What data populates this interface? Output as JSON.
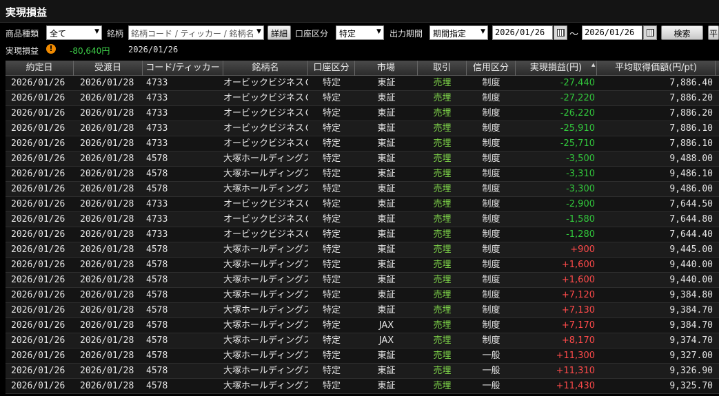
{
  "title": "実現損益",
  "filters": {
    "product_label": "商品種類",
    "product_value": "全て",
    "brand_label": "銘柄",
    "brand_placeholder": "銘柄コード / ティッカー / 銘柄名",
    "detail_button": "詳細",
    "account_label": "口座区分",
    "account_value": "特定",
    "period_label": "出力期間",
    "period_value": "期間指定",
    "date_from": "2026/01/26",
    "tilde": "～",
    "date_to": "2026/01/26",
    "search_button": "検索",
    "cut_button": "平"
  },
  "summary": {
    "label": "実現損益",
    "warning_glyph": "!",
    "value": "-80,640円",
    "date": "2026/01/26"
  },
  "table": {
    "headers": [
      "約定日",
      "受渡日",
      "コード/ティッカー",
      "銘柄名",
      "口座区分",
      "市場",
      "取引",
      "信用区分",
      "実現損益(円)",
      "平均取得価額(円/pt)"
    ],
    "rows": [
      [
        "2026/01/26",
        "2026/01/28",
        "4733",
        "オービックビジネスＣ",
        "特定",
        "東証",
        "売埋",
        "制度",
        "-27,440",
        "7,886.40"
      ],
      [
        "2026/01/26",
        "2026/01/28",
        "4733",
        "オービックビジネスＣ",
        "特定",
        "東証",
        "売埋",
        "制度",
        "-27,220",
        "7,886.20"
      ],
      [
        "2026/01/26",
        "2026/01/28",
        "4733",
        "オービックビジネスＣ",
        "特定",
        "東証",
        "売埋",
        "制度",
        "-26,220",
        "7,886.20"
      ],
      [
        "2026/01/26",
        "2026/01/28",
        "4733",
        "オービックビジネスＣ",
        "特定",
        "東証",
        "売埋",
        "制度",
        "-25,910",
        "7,886.10"
      ],
      [
        "2026/01/26",
        "2026/01/28",
        "4733",
        "オービックビジネスＣ",
        "特定",
        "東証",
        "売埋",
        "制度",
        "-25,710",
        "7,886.10"
      ],
      [
        "2026/01/26",
        "2026/01/28",
        "4578",
        "大塚ホールディングス",
        "特定",
        "東証",
        "売埋",
        "制度",
        "-3,500",
        "9,488.00"
      ],
      [
        "2026/01/26",
        "2026/01/28",
        "4578",
        "大塚ホールディングス",
        "特定",
        "東証",
        "売埋",
        "制度",
        "-3,310",
        "9,486.10"
      ],
      [
        "2026/01/26",
        "2026/01/28",
        "4578",
        "大塚ホールディングス",
        "特定",
        "東証",
        "売埋",
        "制度",
        "-3,300",
        "9,486.00"
      ],
      [
        "2026/01/26",
        "2026/01/28",
        "4733",
        "オービックビジネスＣ",
        "特定",
        "東証",
        "売埋",
        "制度",
        "-2,900",
        "7,644.50"
      ],
      [
        "2026/01/26",
        "2026/01/28",
        "4733",
        "オービックビジネスＣ",
        "特定",
        "東証",
        "売埋",
        "制度",
        "-1,580",
        "7,644.80"
      ],
      [
        "2026/01/26",
        "2026/01/28",
        "4733",
        "オービックビジネスＣ",
        "特定",
        "東証",
        "売埋",
        "制度",
        "-1,280",
        "7,644.40"
      ],
      [
        "2026/01/26",
        "2026/01/28",
        "4578",
        "大塚ホールディングス",
        "特定",
        "東証",
        "売埋",
        "制度",
        "+900",
        "9,445.00"
      ],
      [
        "2026/01/26",
        "2026/01/28",
        "4578",
        "大塚ホールディングス",
        "特定",
        "東証",
        "売埋",
        "制度",
        "+1,600",
        "9,440.00"
      ],
      [
        "2026/01/26",
        "2026/01/28",
        "4578",
        "大塚ホールディングス",
        "特定",
        "東証",
        "売埋",
        "制度",
        "+1,600",
        "9,440.00"
      ],
      [
        "2026/01/26",
        "2026/01/28",
        "4578",
        "大塚ホールディングス",
        "特定",
        "東証",
        "売埋",
        "制度",
        "+7,120",
        "9,384.80"
      ],
      [
        "2026/01/26",
        "2026/01/28",
        "4578",
        "大塚ホールディングス",
        "特定",
        "東証",
        "売埋",
        "制度",
        "+7,130",
        "9,384.70"
      ],
      [
        "2026/01/26",
        "2026/01/28",
        "4578",
        "大塚ホールディングス",
        "特定",
        "JAX",
        "売埋",
        "制度",
        "+7,170",
        "9,384.70"
      ],
      [
        "2026/01/26",
        "2026/01/28",
        "4578",
        "大塚ホールディングス",
        "特定",
        "JAX",
        "売埋",
        "制度",
        "+8,170",
        "9,374.70"
      ],
      [
        "2026/01/26",
        "2026/01/28",
        "4578",
        "大塚ホールディングス",
        "特定",
        "東証",
        "売埋",
        "一般",
        "+11,300",
        "9,327.00"
      ],
      [
        "2026/01/26",
        "2026/01/28",
        "4578",
        "大塚ホールディングス",
        "特定",
        "東証",
        "売埋",
        "一般",
        "+11,310",
        "9,326.90"
      ],
      [
        "2026/01/26",
        "2026/01/28",
        "4578",
        "大塚ホールディングス",
        "特定",
        "東証",
        "売埋",
        "一般",
        "+11,430",
        "9,325.70"
      ]
    ]
  },
  "colors": {
    "loss": "#32c83c",
    "gain": "#ff4a4a",
    "trade": "#7fd64a"
  }
}
